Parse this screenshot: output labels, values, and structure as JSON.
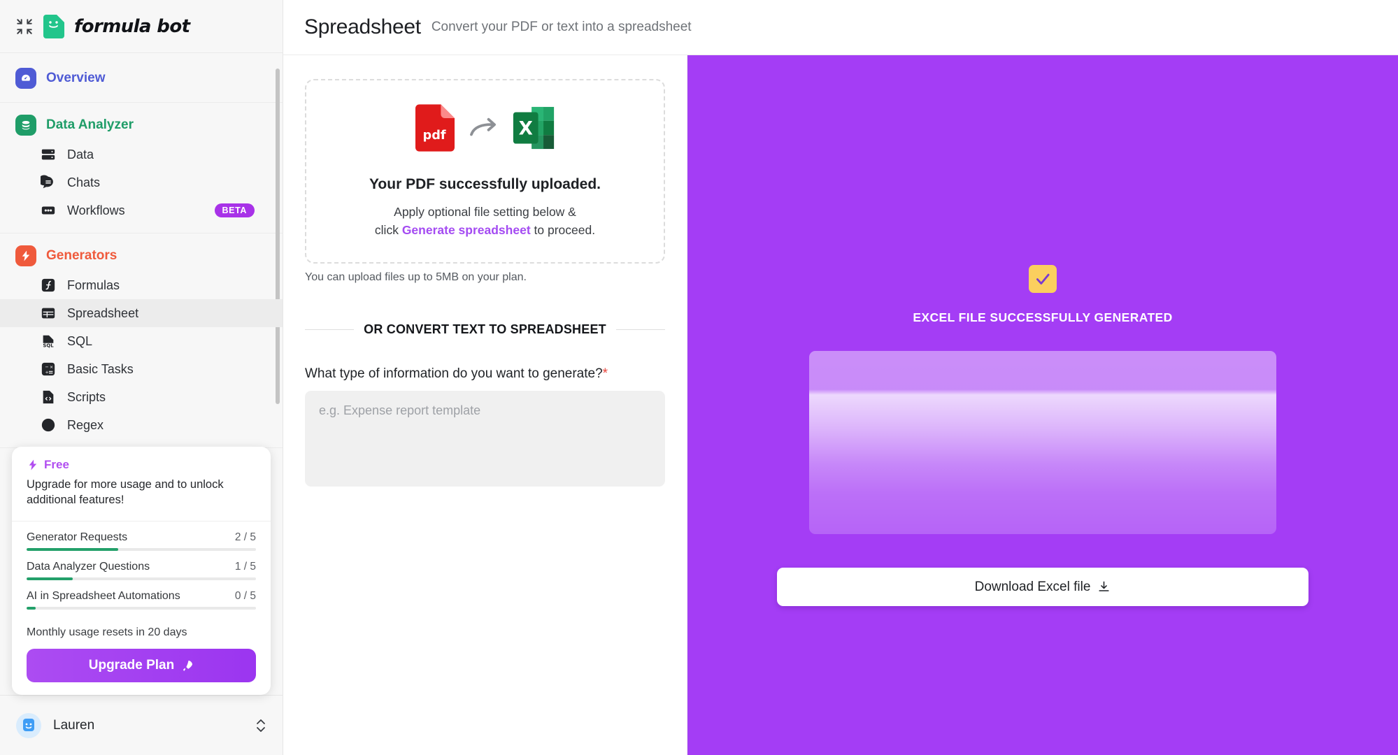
{
  "sidebar": {
    "logo_text": "formula bot",
    "collapse_icon": "collapse-arrows-icon",
    "sections": [
      {
        "id": "overview",
        "head_label": "Overview",
        "head_icon": "speedometer-icon",
        "head_color": "#4f5bd5",
        "items": []
      },
      {
        "id": "data-analyzer",
        "head_label": "Data Analyzer",
        "head_icon": "database-icon",
        "head_color": "#1f9d68",
        "items": [
          {
            "label": "Data",
            "icon": "server-icon",
            "badge": "",
            "active": false
          },
          {
            "label": "Chats",
            "icon": "chat-bubble-icon",
            "badge": "",
            "active": false
          },
          {
            "label": "Workflows",
            "icon": "workflow-dots-icon",
            "badge": "BETA",
            "active": false
          }
        ]
      },
      {
        "id": "generators",
        "head_label": "Generators",
        "head_icon": "lightning-bolt-icon",
        "head_color": "#ef5a3c",
        "items": [
          {
            "label": "Formulas",
            "icon": "function-icon",
            "badge": "",
            "active": false
          },
          {
            "label": "Spreadsheet",
            "icon": "table-icon",
            "badge": "",
            "active": true
          },
          {
            "label": "SQL",
            "icon": "sql-file-icon",
            "badge": "",
            "active": false
          },
          {
            "label": "Basic Tasks",
            "icon": "calculator-icon",
            "badge": "",
            "active": false
          },
          {
            "label": "Scripts",
            "icon": "code-file-icon",
            "badge": "",
            "active": false
          },
          {
            "label": "Regex",
            "icon": "regex-icon",
            "badge": "",
            "active": false
          }
        ]
      }
    ],
    "upgrade_card": {
      "plan_label": "Free",
      "plan_icon": "lightning-bolt-icon",
      "description": "Upgrade for more usage and to unlock additional features!",
      "meters": [
        {
          "label": "Generator Requests",
          "value": "2 / 5",
          "percent": 40
        },
        {
          "label": "Data Analyzer Questions",
          "value": "1 / 5",
          "percent": 20
        },
        {
          "label": "AI in Spreadsheet Automations",
          "value": "0 / 5",
          "percent": 4
        }
      ],
      "reset_note": "Monthly usage resets in 20 days",
      "button_label": "Upgrade Plan",
      "button_icon": "rocket-icon",
      "accent_color": "#a832e8",
      "meter_color": "#23a06a"
    },
    "footer": {
      "user_name": "Lauren",
      "avatar_icon": "user-avatar-icon",
      "expand_icon": "chevron-up-down-icon"
    }
  },
  "header": {
    "title": "Spreadsheet",
    "subtitle": "Convert your PDF or text into a spreadsheet"
  },
  "left_pane": {
    "upload_card": {
      "pdf_icon": "pdf-file-icon",
      "pdf_label": "pdf",
      "arrow_icon": "curved-arrow-right-icon",
      "excel_icon": "excel-file-icon",
      "excel_label": "X",
      "title": "Your PDF successfully uploaded.",
      "sub_line1": "Apply optional file setting below &",
      "sub_line2_pre": "click ",
      "sub_line2_accent": "Generate spreadsheet",
      "sub_line2_post": " to proceed.",
      "accent_color": "#a44bf2"
    },
    "upload_note": "You can upload files up to 5MB on your plan.",
    "divider_label": "OR CONVERT TEXT TO SPREADSHEET",
    "form": {
      "question_label": "What type of information do you want to generate?",
      "required_mark": "*",
      "textarea_placeholder": "e.g. Expense report template",
      "textarea_value": ""
    }
  },
  "right_pane": {
    "background_color": "#a43df5",
    "check_icon": "checkbox-checked-icon",
    "check_color": "#fbcf5e",
    "success_label": "EXCEL FILE SUCCESSFULLY GENERATED",
    "preview_icon": "spreadsheet-preview-placeholder",
    "download_label": "Download Excel file",
    "download_icon": "download-icon"
  }
}
